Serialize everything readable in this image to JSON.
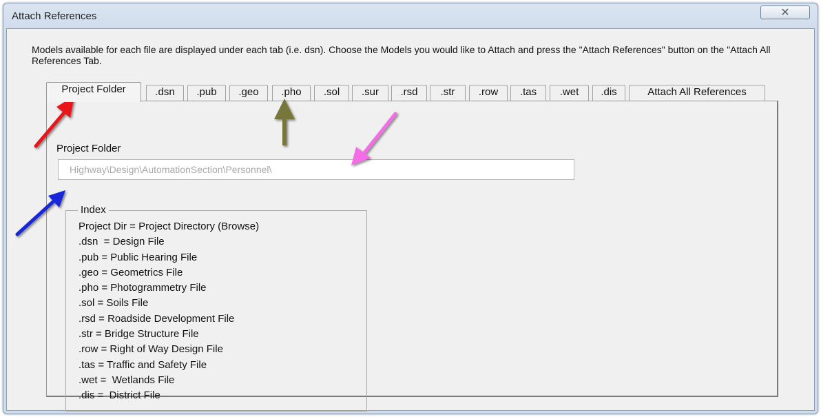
{
  "window": {
    "title": "Attach References",
    "close_glyph": "✕"
  },
  "description": "Models available for each file are displayed under each tab (i.e. dsn).  Choose the Models you would like to Attach and press the \"Attach References\" button on the \"Attach All References Tab.",
  "tabs": [
    {
      "label": "Project Folder",
      "active": true
    },
    {
      "label": ".dsn",
      "active": false
    },
    {
      "label": ".pub",
      "active": false
    },
    {
      "label": ".geo",
      "active": false
    },
    {
      "label": ".pho",
      "active": false
    },
    {
      "label": ".sol",
      "active": false
    },
    {
      "label": ".sur",
      "active": false
    },
    {
      "label": ".rsd",
      "active": false
    },
    {
      "label": ".str",
      "active": false
    },
    {
      "label": ".row",
      "active": false
    },
    {
      "label": ".tas",
      "active": false
    },
    {
      "label": ".wet",
      "active": false
    },
    {
      "label": ".dis",
      "active": false
    },
    {
      "label": "Attach All References",
      "active": false
    }
  ],
  "project_folder": {
    "label": "Project Folder",
    "value": "Highway\\Design\\AutomationSection\\Personnel\\"
  },
  "index": {
    "legend": "Index",
    "items": [
      "Project Dir = Project Directory (Browse)",
      ".dsn  = Design File",
      ".pub = Public Hearing File",
      ".geo = Geometrics File",
      ".pho = Photogrammetry File",
      ".sol = Soils File",
      ".rsd = Roadside Development File",
      ".str = Bridge Structure File",
      ".row = Right of Way Design File",
      ".tas = Traffic and Safety File",
      ".wet =  Wetlands File",
      ".dis =  District File"
    ]
  },
  "annotation_colors": {
    "red": "#e8141b",
    "olive": "#77773a",
    "pink": "#f36ee6",
    "blue": "#1826d8"
  }
}
